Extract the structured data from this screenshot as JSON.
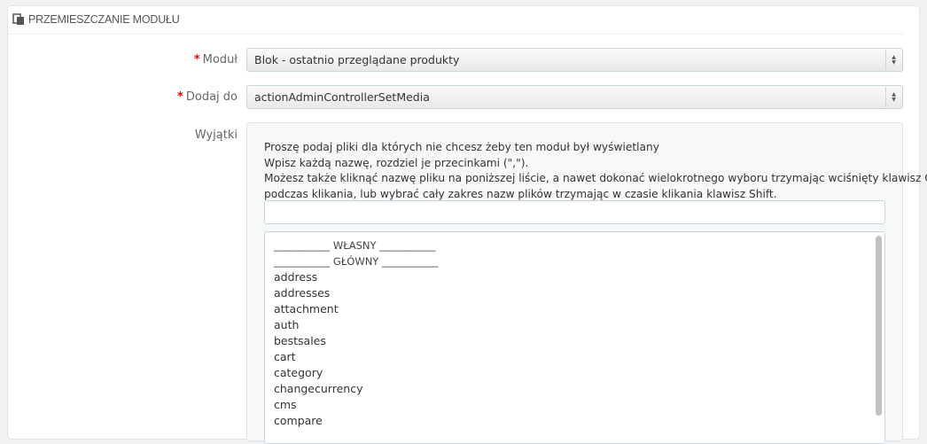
{
  "panel": {
    "heading": "PRZEMIESZCZANIE MODUŁU",
    "icon": "paste-icon"
  },
  "form": {
    "module": {
      "required_mark": "*",
      "label": "Moduł",
      "selected": "Blok - ostatnio przeglądane produkty"
    },
    "hook": {
      "required_mark": "*",
      "label": "Dodaj do",
      "selected": "actionAdminControllerSetMedia"
    },
    "exceptions": {
      "label": "Wyjątki",
      "help": [
        "Proszę podaj pliki dla których nie chcesz żeby ten moduł był wyświetlany",
        "Wpisz każdą nazwę, rozdziel je przecinkami (\",\").",
        "Możesz także kliknąć nazwę pliku na poniższej liście, a nawet dokonać wielokrotnego wyboru trzymając wciśnięty klawisz Ctrl",
        "podczas klikania, lub wybrać cały zakres nazw plików trzymając w czasie klikania klawisz Shift."
      ],
      "input_value": "",
      "list": [
        "___________ WŁASNY ___________",
        "___________ GŁÓWNY ___________",
        "address",
        "addresses",
        "attachment",
        "auth",
        "bestsales",
        "cart",
        "category",
        "changecurrency",
        "cms",
        "compare"
      ]
    }
  }
}
